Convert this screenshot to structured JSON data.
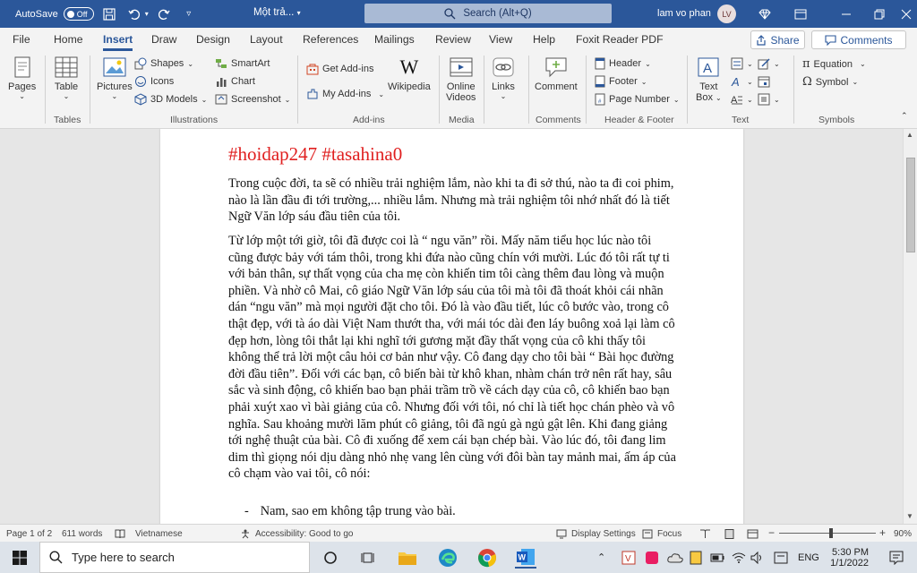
{
  "titlebar": {
    "autosave_label": "AutoSave",
    "autosave_state": "Off",
    "doc_title": "Một trả...",
    "search_placeholder": "Search (Alt+Q)",
    "user_name": "lam vo phan",
    "user_initials": "LV"
  },
  "tabs": [
    "File",
    "Home",
    "Insert",
    "Draw",
    "Design",
    "Layout",
    "References",
    "Mailings",
    "Review",
    "View",
    "Help",
    "Foxit Reader PDF"
  ],
  "active_tab": "Insert",
  "share_label": "Share",
  "comments_label": "Comments",
  "ribbon": {
    "pages": "Pages",
    "table": "Table",
    "pictures": "Pictures",
    "shapes": "Shapes",
    "icons": "Icons",
    "models3d": "3D Models",
    "smartart": "SmartArt",
    "chart": "Chart",
    "screenshot": "Screenshot",
    "get_addins": "Get Add-ins",
    "my_addins": "My Add-ins",
    "wikipedia": "Wikipedia",
    "online_videos_1": "Online",
    "online_videos_2": "Videos",
    "links": "Links",
    "comment": "Comment",
    "header": "Header",
    "footer": "Footer",
    "page_number": "Page Number",
    "text_box_1": "Text",
    "text_box_2": "Box",
    "equation": "Equation",
    "symbol": "Symbol",
    "groups": {
      "tables": "Tables",
      "illustrations": "Illustrations",
      "addins": "Add-ins",
      "media": "Media",
      "comments": "Comments",
      "header_footer": "Header & Footer",
      "text": "Text",
      "symbols": "Symbols"
    }
  },
  "document": {
    "heading": "#hoidap247 #tasahina0",
    "para1": "Trong cuộc đời, ta sẽ có nhiều trải nghiệm lắm, nào khi ta đi sở thú, nào ta đi coi phim, nào là lần đầu đi tới trường,... nhiều lắm. Nhưng mà trải nghiệm tôi nhớ nhất đó là tiết Ngữ Văn lớp sáu đầu tiên của tôi.",
    "para2": "Từ lớp một tới giờ, tôi đã được coi là “ ngu văn” rồi. Mấy năm tiểu học lúc nào tôi cũng được bảy với tám thôi, trong khi đứa nào cũng chín với mười. Lúc đó tôi rất tự ti với bản thân, sự thất vọng của cha mẹ còn khiến tim tôi càng thêm đau lòng và muộn phiền. Và nhờ cô Mai, cô giáo Ngữ Văn lớp sáu của tôi mà tôi đã thoát khỏi cái nhãn dán “ngu văn” mà mọi người đặt cho tôi. Đó là vào đầu tiết, lúc cô bước vào, trong cô thật đẹp, với tà áo dài Việt Nam thướt tha, với mái tóc dài đen láy buông xoả lại làm cô đẹp hơn,  lòng tôi thắt lại khi nghĩ tới gương mặt đầy thất vọng của cô khi thấy tôi không thể trả lời một câu hỏi cơ bản như vậy. Cô đang dạy cho tôi bài “ Bài học đường đời đầu tiên”. Đối với các bạn, cô biến bài từ khô khan, nhàm chán trở nên rất hay, sâu sắc và sinh động, cô khiến bao bạn phải trầm trồ về cách dạy của cô, cô khiến bao bạn phải xuýt xao vì bài giảng của cô. Nhưng đối với tôi, nó chỉ là tiết học chán phèo và vô nghĩa. Sau khoảng mười lăm phút cô giảng, tôi đã ngủ gà ngủ gật lên. Khi đang giảng tới nghệ thuật của bài. Cô đi xuống để xem cái bạn chép bài. Vào lúc đó, tôi đang lim dim thì giọng nói dịu dàng nhỏ nhẹ vang lên cùng với đôi bàn tay mảnh mai, ấm áp của cô chạm vào vai tôi, cô nói:",
    "bullet_dash": "-",
    "bullet": "Nam, sao em không tập trung vào bài."
  },
  "statusbar": {
    "page": "Page 1 of 2",
    "words": "611 words",
    "language": "Vietnamese",
    "accessibility": "Accessibility: Good to go",
    "display_settings": "Display Settings",
    "focus": "Focus",
    "zoom": "90%"
  },
  "taskbar": {
    "search_placeholder": "Type here to search",
    "lang": "ENG",
    "time": "5:30 PM",
    "date": "1/1/2022"
  },
  "colors": {
    "word_blue": "#2b579a",
    "heading_red": "#e02020"
  }
}
